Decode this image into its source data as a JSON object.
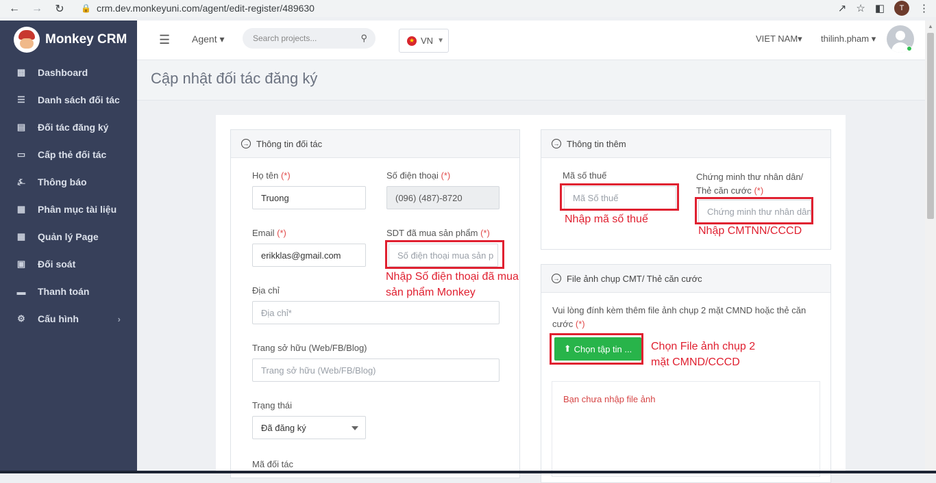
{
  "browser": {
    "url": "crm.dev.monkeyuni.com/agent/edit-register/489630",
    "profile_initial": "T"
  },
  "sidebar": {
    "brand": "Monkey CRM",
    "items": [
      {
        "label": "Dashboard",
        "icon": "bar-chart-icon"
      },
      {
        "label": "Danh sách đối tác",
        "icon": "list-icon"
      },
      {
        "label": "Đối tác đăng ký",
        "icon": "document-icon"
      },
      {
        "label": "Cấp thẻ đối tác",
        "icon": "card-icon"
      },
      {
        "label": "Thông báo",
        "icon": "bell-icon"
      },
      {
        "label": "Phân mục tài liệu",
        "icon": "book-icon"
      },
      {
        "label": "Quản lý Page",
        "icon": "book-icon"
      },
      {
        "label": "Đối soát",
        "icon": "briefcase-icon"
      },
      {
        "label": "Thanh toán",
        "icon": "credit-card-icon"
      },
      {
        "label": "Cấu hình",
        "icon": "gear-icon"
      }
    ]
  },
  "topbar": {
    "agent_label": "Agent",
    "search_placeholder": "Search projects...",
    "language": "VN",
    "country": "VIET NAM",
    "username": "thilinh.pham"
  },
  "page": {
    "title": "Cập nhật đối tác đăng ký"
  },
  "partner_info": {
    "header": "Thông tin đối tác",
    "name_label": "Họ tên",
    "name_value": "Truong",
    "phone_label": "Số điện thoại",
    "phone_value": "(096) (487)-8720",
    "email_label": "Email",
    "email_value": "erikklas@gmail.com",
    "product_phone_label": "SDT đã mua sản phẩm",
    "product_phone_placeholder": "Số điện thoại mua sản p",
    "address_label": "Địa chỉ",
    "address_placeholder": "Địa chỉ*",
    "website_label": "Trang sở hữu (Web/FB/Blog)",
    "website_placeholder": "Trang sở hữu (Web/FB/Blog)",
    "status_label": "Trạng thái",
    "status_value": "Đã đăng ký",
    "partner_code_label": "Mã đối tác",
    "required_mark": "(*)"
  },
  "extra_info": {
    "header": "Thông tin thêm",
    "tax_label": "Mã số thuế",
    "tax_placeholder": "Mã Số thuế",
    "id_label_line1": "Chứng minh thư nhân dân/",
    "id_label_line2": "Thẻ căn cước",
    "id_placeholder": "Chứng minh thư nhân dân"
  },
  "file_panel": {
    "header": "File ảnh chụp CMT/ Thẻ căn cước",
    "instruction": "Vui lòng đính kèm thêm file ảnh chụp 2 mặt CMND hoặc thẻ căn cước",
    "choose_button": "Chọn tập tin ...",
    "empty_message": "Bạn chưa nhập file ảnh"
  },
  "annotations": {
    "product_phone": "Nhập Số điện thoại đã mua sản phẩm Monkey",
    "tax": "Nhập mã số thuế",
    "id": "Nhập CMTNN/CCCD",
    "file": "Chọn File ảnh chụp 2 mặt CMND/CCCD"
  },
  "colors": {
    "sidebar_bg": "#37405a",
    "annotation_red": "#e02030",
    "button_green": "#28b44a"
  }
}
